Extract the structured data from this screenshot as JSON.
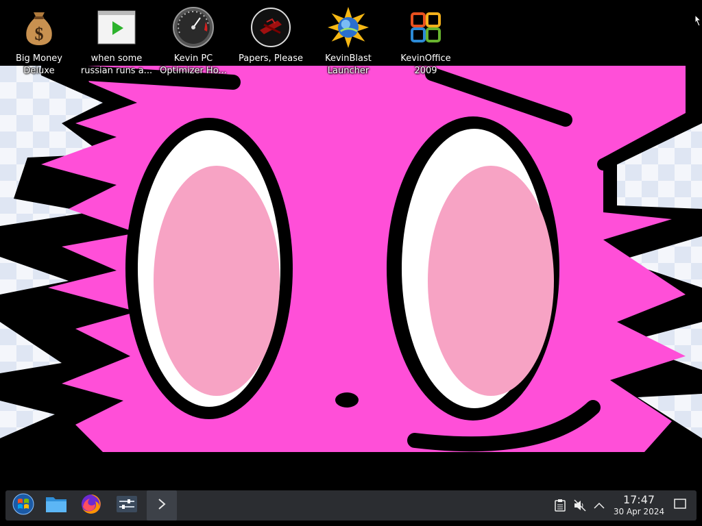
{
  "desktop": {
    "icons": [
      {
        "label": "Big Money\nDeluxe",
        "icon": "money-bag-icon"
      },
      {
        "label": "when some\nrussian runs a...",
        "icon": "video-file-icon"
      },
      {
        "label": "Kevin PC\nOptimizer Ho...",
        "icon": "speedometer-icon"
      },
      {
        "label": "Papers, Please",
        "icon": "papers-please-icon"
      },
      {
        "label": "KevinBlast\nLauncher",
        "icon": "globe-star-icon"
      },
      {
        "label": "KevinOffice\n2009",
        "icon": "office-logo-icon"
      }
    ]
  },
  "taskbar": {
    "apps": [
      {
        "icon": "start-menu-icon"
      },
      {
        "icon": "file-manager-icon"
      },
      {
        "icon": "firefox-icon"
      },
      {
        "icon": "settings-sliders-icon"
      },
      {
        "icon": "terminal-icon"
      }
    ],
    "tray": [
      {
        "icon": "clipboard-icon"
      },
      {
        "icon": "volume-muted-icon"
      },
      {
        "icon": "chevron-up-icon"
      }
    ],
    "clock": {
      "time": "17:47",
      "date": "30 Apr 2024"
    },
    "show_desktop_icon": "show-desktop-icon"
  },
  "colors": {
    "wallpaper_pink": "#ff4fd8",
    "eye_pink": "#f7a3c4",
    "taskbar_bg": "#2b2d31"
  }
}
